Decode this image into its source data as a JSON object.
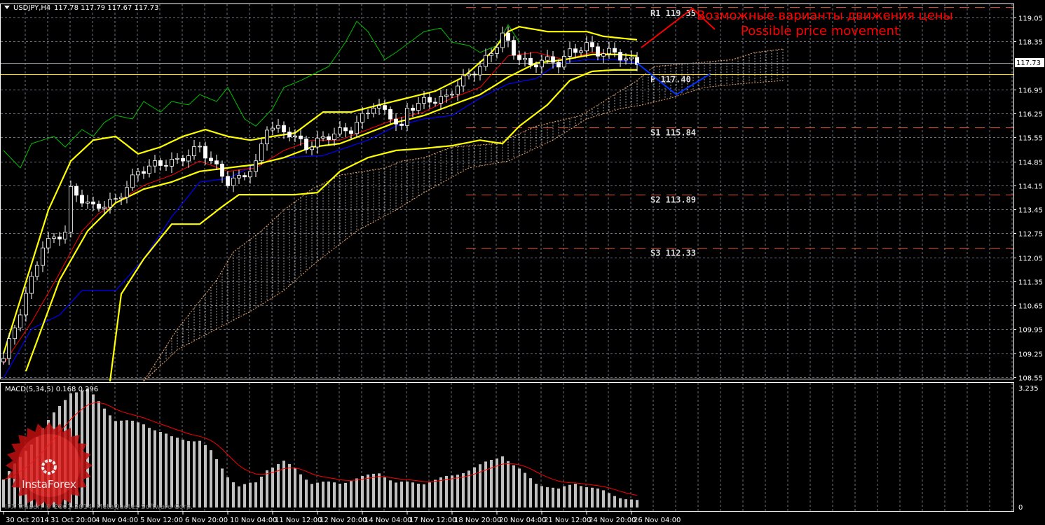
{
  "header": {
    "symbol": "USDJPY,H4",
    "ohlc": "117.78 117.79 117.67 117.73"
  },
  "copyright": "IFX Trader, © 2001-2014, MetaQuotes Software Corp.",
  "logo_text": "InstaForex",
  "annotation": {
    "ru": "Возможные варианты движения цены",
    "en": "Possible price movement"
  },
  "colors": {
    "bb": "#ffff00",
    "tenkan": "#ff0000",
    "kijun": "#0000ff",
    "chikou": "#00c000",
    "cloud": "#f4a460",
    "pivot_p": "#ffd700",
    "pivot_sr": "#e05030",
    "annotation": "#ff0000",
    "macd_bar": "#c0c0c0",
    "macd_signal": "#ff0000"
  },
  "chart_data": {
    "type": "candlestick",
    "symbol": "USDJPY",
    "timeframe": "H4",
    "last_price": "117.73",
    "y_ticks": [
      "119.05",
      "118.35",
      "116.95",
      "116.25",
      "115.55",
      "114.85",
      "114.15",
      "113.45",
      "112.75",
      "112.05",
      "111.35",
      "110.65",
      "109.95",
      "109.25",
      "108.55"
    ],
    "ylim": [
      108.55,
      119.05
    ],
    "x_ticks": [
      {
        "bar": 0,
        "label": "30 Oct 2014"
      },
      {
        "bar": 8,
        "label": "31 Oct 20:00"
      },
      {
        "bar": 16,
        "label": "4 Nov 04:00"
      },
      {
        "bar": 24,
        "label": "5 Nov 12:00"
      },
      {
        "bar": 32,
        "label": "6 Nov 20:00"
      },
      {
        "bar": 40,
        "label": "10 Nov 04:00"
      },
      {
        "bar": 48,
        "label": "11 Nov 12:00"
      },
      {
        "bar": 56,
        "label": "12 Nov 20:00"
      },
      {
        "bar": 64,
        "label": "14 Nov 04:00"
      },
      {
        "bar": 72,
        "label": "17 Nov 12:00"
      },
      {
        "bar": 80,
        "label": "18 Nov 20:00"
      },
      {
        "bar": 88,
        "label": "20 Nov 04:00"
      },
      {
        "bar": 96,
        "label": "21 Nov 12:00"
      },
      {
        "bar": 104,
        "label": "24 Nov 20:00"
      },
      {
        "bar": 112,
        "label": "26 Nov 04:00"
      }
    ],
    "close_path": [
      [
        0,
        109.1
      ],
      [
        5,
        111.4
      ],
      [
        7,
        112.4
      ],
      [
        11,
        112.8
      ],
      [
        12,
        114.0
      ],
      [
        16,
        113.5
      ],
      [
        20,
        113.7
      ],
      [
        24,
        114.55
      ],
      [
        27,
        114.76
      ],
      [
        31,
        114.86
      ],
      [
        35,
        115.27
      ],
      [
        37,
        114.86
      ],
      [
        40,
        114.25
      ],
      [
        42,
        114.35
      ],
      [
        45,
        114.76
      ],
      [
        47,
        115.88
      ],
      [
        51,
        115.68
      ],
      [
        54,
        115.27
      ],
      [
        59,
        115.68
      ],
      [
        62,
        115.78
      ],
      [
        66,
        116.5
      ],
      [
        69,
        116.19
      ],
      [
        71,
        115.78
      ],
      [
        72,
        116.39
      ],
      [
        75,
        116.6
      ],
      [
        79,
        116.7
      ],
      [
        81,
        117.11
      ],
      [
        85,
        117.62
      ],
      [
        87,
        118.03
      ],
      [
        89,
        118.54
      ],
      [
        91,
        118.03
      ],
      [
        94,
        117.62
      ],
      [
        96,
        117.82
      ],
      [
        99,
        117.72
      ],
      [
        101,
        118.03
      ],
      [
        104,
        118.23
      ],
      [
        106,
        118.03
      ],
      [
        109,
        118.03
      ],
      [
        111,
        117.82
      ],
      [
        113,
        117.73
      ]
    ],
    "bollinger_upper": [
      [
        0,
        109.24
      ],
      [
        8,
        113.43
      ],
      [
        12,
        114.86
      ],
      [
        16,
        115.47
      ],
      [
        20,
        115.58
      ],
      [
        24,
        115.07
      ],
      [
        28,
        115.27
      ],
      [
        32,
        115.58
      ],
      [
        36,
        115.78
      ],
      [
        40,
        115.58
      ],
      [
        44,
        115.47
      ],
      [
        48,
        115.58
      ],
      [
        52,
        115.68
      ],
      [
        57,
        116.29
      ],
      [
        62,
        116.29
      ],
      [
        67,
        116.5
      ],
      [
        72,
        116.7
      ],
      [
        77,
        116.9
      ],
      [
        82,
        117.31
      ],
      [
        87,
        118.03
      ],
      [
        90,
        118.64
      ],
      [
        92,
        118.78
      ],
      [
        97,
        118.64
      ],
      [
        104,
        118.64
      ],
      [
        107,
        118.5
      ],
      [
        113,
        118.4
      ]
    ],
    "bollinger_middle": [
      [
        4,
        108.73
      ],
      [
        10,
        111.39
      ],
      [
        15,
        112.82
      ],
      [
        20,
        113.64
      ],
      [
        25,
        114.04
      ],
      [
        30,
        114.25
      ],
      [
        35,
        114.56
      ],
      [
        40,
        114.66
      ],
      [
        45,
        114.76
      ],
      [
        50,
        114.96
      ],
      [
        55,
        115.27
      ],
      [
        60,
        115.37
      ],
      [
        65,
        115.68
      ],
      [
        70,
        115.99
      ],
      [
        75,
        116.19
      ],
      [
        80,
        116.5
      ],
      [
        85,
        116.8
      ],
      [
        90,
        117.31
      ],
      [
        95,
        117.72
      ],
      [
        100,
        117.82
      ],
      [
        105,
        117.97
      ],
      [
        110,
        117.97
      ],
      [
        113,
        117.93
      ]
    ],
    "bollinger_lower": [
      [
        19,
        108.43
      ],
      [
        21,
        110.98
      ],
      [
        25,
        112.0
      ],
      [
        30,
        113.02
      ],
      [
        35,
        113.02
      ],
      [
        39,
        113.53
      ],
      [
        42,
        113.88
      ],
      [
        47,
        113.88
      ],
      [
        52,
        113.88
      ],
      [
        56,
        113.94
      ],
      [
        60,
        114.56
      ],
      [
        65,
        114.96
      ],
      [
        70,
        115.17
      ],
      [
        75,
        115.23
      ],
      [
        80,
        115.31
      ],
      [
        85,
        115.47
      ],
      [
        89,
        115.37
      ],
      [
        92,
        115.88
      ],
      [
        97,
        116.5
      ],
      [
        101,
        117.21
      ],
      [
        105,
        117.48
      ],
      [
        109,
        117.52
      ],
      [
        113,
        117.52
      ]
    ],
    "tenkan": [
      [
        0,
        108.94
      ],
      [
        5,
        110.16
      ],
      [
        10,
        111.59
      ],
      [
        14,
        112.82
      ],
      [
        17,
        113.33
      ],
      [
        21,
        113.74
      ],
      [
        25,
        114.15
      ],
      [
        30,
        114.45
      ],
      [
        35,
        114.86
      ],
      [
        40,
        114.56
      ],
      [
        45,
        114.66
      ],
      [
        50,
        115.17
      ],
      [
        55,
        115.47
      ],
      [
        60,
        115.47
      ],
      [
        65,
        115.78
      ],
      [
        70,
        116.09
      ],
      [
        75,
        116.29
      ],
      [
        80,
        116.7
      ],
      [
        85,
        117.01
      ],
      [
        90,
        117.93
      ],
      [
        95,
        118.03
      ],
      [
        100,
        117.82
      ],
      [
        105,
        118.03
      ],
      [
        110,
        117.97
      ],
      [
        113,
        117.93
      ]
    ],
    "kijun": [
      [
        0,
        108.53
      ],
      [
        5,
        109.96
      ],
      [
        10,
        110.37
      ],
      [
        14,
        111.08
      ],
      [
        20,
        111.08
      ],
      [
        25,
        112.0
      ],
      [
        30,
        113.23
      ],
      [
        35,
        114.25
      ],
      [
        40,
        114.35
      ],
      [
        45,
        114.76
      ],
      [
        50,
        114.96
      ],
      [
        57,
        115.02
      ],
      [
        65,
        115.47
      ],
      [
        70,
        115.88
      ],
      [
        75,
        116.09
      ],
      [
        80,
        116.19
      ],
      [
        85,
        116.7
      ],
      [
        90,
        117.11
      ],
      [
        95,
        117.27
      ],
      [
        99,
        117.72
      ],
      [
        104,
        117.82
      ],
      [
        109,
        117.82
      ],
      [
        113,
        117.72
      ]
    ],
    "forecast_path": [
      [
        113,
        117.72
      ],
      [
        120,
        116.8
      ],
      [
        126,
        117.4
      ]
    ],
    "chikou": [
      [
        0,
        115.17
      ],
      [
        3,
        114.66
      ],
      [
        5,
        115.37
      ],
      [
        9,
        115.58
      ],
      [
        11,
        115.27
      ],
      [
        14,
        115.78
      ],
      [
        16,
        115.58
      ],
      [
        18,
        115.99
      ],
      [
        20,
        116.19
      ],
      [
        23,
        116.09
      ],
      [
        25,
        116.6
      ],
      [
        28,
        116.29
      ],
      [
        30,
        116.6
      ],
      [
        33,
        116.5
      ],
      [
        35,
        116.8
      ],
      [
        38,
        116.6
      ],
      [
        40,
        117.01
      ],
      [
        43,
        116.09
      ],
      [
        45,
        115.88
      ],
      [
        48,
        116.39
      ],
      [
        50,
        117.01
      ],
      [
        53,
        117.21
      ],
      [
        58,
        117.62
      ],
      [
        61,
        118.33
      ],
      [
        63,
        118.94
      ],
      [
        65,
        118.64
      ],
      [
        68,
        117.82
      ],
      [
        70,
        118.03
      ],
      [
        75,
        118.64
      ],
      [
        78,
        118.74
      ],
      [
        80,
        118.33
      ],
      [
        83,
        118.23
      ],
      [
        85,
        118.03
      ],
      [
        88,
        118.23
      ],
      [
        90,
        118.84
      ],
      [
        92,
        118.33
      ]
    ],
    "cloud_upper": [
      [
        25,
        108.43
      ],
      [
        31,
        109.96
      ],
      [
        38,
        111.39
      ],
      [
        41,
        112.21
      ],
      [
        46,
        112.82
      ],
      [
        50,
        113.43
      ],
      [
        55,
        114.04
      ],
      [
        60,
        114.45
      ],
      [
        68,
        114.66
      ],
      [
        71,
        114.86
      ],
      [
        75,
        114.96
      ],
      [
        80,
        115.27
      ],
      [
        88,
        115.37
      ],
      [
        95,
        115.88
      ],
      [
        103,
        116.19
      ],
      [
        108,
        116.7
      ],
      [
        113,
        117.21
      ],
      [
        116,
        117.62
      ],
      [
        123,
        117.72
      ],
      [
        130,
        117.82
      ],
      [
        134,
        118.03
      ],
      [
        139,
        118.13
      ]
    ],
    "cloud_lower": [
      [
        25,
        108.43
      ],
      [
        31,
        109.35
      ],
      [
        38,
        109.96
      ],
      [
        44,
        110.47
      ],
      [
        50,
        111.08
      ],
      [
        55,
        111.8
      ],
      [
        63,
        112.82
      ],
      [
        70,
        113.43
      ],
      [
        75,
        113.94
      ],
      [
        83,
        114.66
      ],
      [
        90,
        114.86
      ],
      [
        98,
        115.47
      ],
      [
        104,
        116.09
      ],
      [
        110,
        116.39
      ],
      [
        114,
        116.5
      ],
      [
        119,
        116.7
      ],
      [
        125,
        117.01
      ],
      [
        131,
        117.11
      ],
      [
        139,
        117.21
      ]
    ],
    "pivots": [
      {
        "name": "R1",
        "label": "R1 119.35",
        "value": 119.35
      },
      {
        "name": "P",
        "label": "P 117.40",
        "value": 117.4
      },
      {
        "name": "S1",
        "label": "S1 115.84",
        "value": 115.84
      },
      {
        "name": "S2",
        "label": "S2 113.89",
        "value": 113.89
      },
      {
        "name": "S3",
        "label": "S3 112.33",
        "value": 112.33
      }
    ],
    "macd": {
      "title": "MACD(5,34,5) 0.168 0.296",
      "params": [
        5,
        34,
        5
      ],
      "value": 0.168,
      "signal": 0.296,
      "ylim": [
        0,
        3.235
      ],
      "y_ticks": [
        "3.235",
        "0"
      ],
      "hist_path": [
        [
          0,
          0.76
        ],
        [
          12,
          3.14
        ],
        [
          15,
          3.2
        ],
        [
          20,
          2.38
        ],
        [
          25,
          2.28
        ],
        [
          30,
          1.9
        ],
        [
          35,
          1.81
        ],
        [
          37,
          1.52
        ],
        [
          40,
          0.86
        ],
        [
          42,
          0.57
        ],
        [
          45,
          0.67
        ],
        [
          47,
          1.05
        ],
        [
          50,
          1.24
        ],
        [
          52,
          1.05
        ],
        [
          55,
          0.67
        ],
        [
          60,
          0.67
        ],
        [
          65,
          0.86
        ],
        [
          67,
          0.95
        ],
        [
          70,
          0.67
        ],
        [
          75,
          0.67
        ],
        [
          80,
          0.86
        ],
        [
          85,
          1.14
        ],
        [
          89,
          1.43
        ],
        [
          91,
          1.14
        ],
        [
          95,
          0.67
        ],
        [
          99,
          0.48
        ],
        [
          102,
          0.67
        ],
        [
          106,
          0.48
        ],
        [
          110,
          0.29
        ],
        [
          113,
          0.168
        ]
      ]
    }
  }
}
